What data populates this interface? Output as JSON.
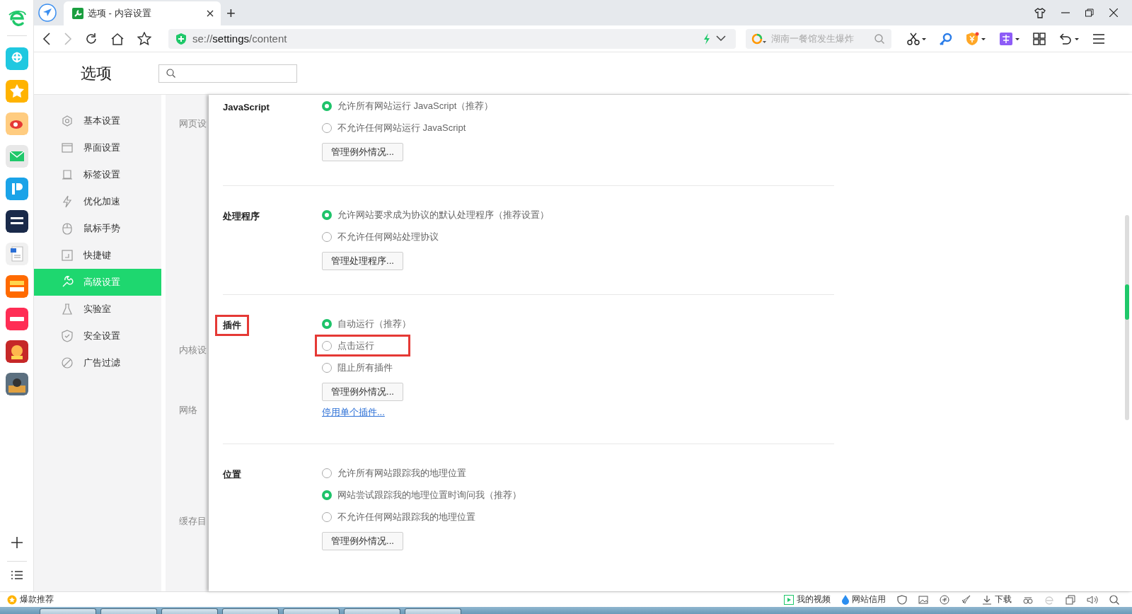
{
  "browser": {
    "tab": {
      "title": "选项 - 内容设置",
      "selected": true
    },
    "new_tab": "+",
    "address": "se://**settings**/content",
    "search": {
      "placeholder": "湖南一餐馆发生爆炸"
    }
  },
  "settings": {
    "title": "选项",
    "nav": [
      {
        "label": "基本设置",
        "selected": false
      },
      {
        "label": "界面设置",
        "selected": false
      },
      {
        "label": "标签设置",
        "selected": false
      },
      {
        "label": "优化加速",
        "selected": false
      },
      {
        "label": "鼠标手势",
        "selected": false
      },
      {
        "label": "快捷键",
        "selected": false
      },
      {
        "label": "高级设置",
        "selected": true
      },
      {
        "label": "实验室",
        "selected": false
      },
      {
        "label": "安全设置",
        "selected": false
      },
      {
        "label": "广告过滤",
        "selected": false
      }
    ],
    "side_labels": [
      "网页设",
      "内核设",
      "网络",
      "缓存目"
    ],
    "sections": [
      {
        "heading": "JavaScript",
        "highlighted": false,
        "options": [
          {
            "label": "允许所有网站运行 JavaScript（推荐）",
            "selected": true,
            "highlighted": false
          },
          {
            "label": "不允许任何网站运行 JavaScript",
            "selected": false,
            "highlighted": false
          }
        ],
        "buttons": [
          "管理例外情况..."
        ]
      },
      {
        "heading": "处理程序",
        "highlighted": false,
        "options": [
          {
            "label": "允许网站要求成为协议的默认处理程序（推荐设置）",
            "selected": true,
            "highlighted": false
          },
          {
            "label": "不允许任何网站处理协议",
            "selected": false,
            "highlighted": false
          }
        ],
        "buttons": [
          "管理处理程序..."
        ]
      },
      {
        "heading": "插件",
        "highlighted": true,
        "options": [
          {
            "label": "自动运行（推荐）",
            "selected": true,
            "highlighted": false
          },
          {
            "label": "点击运行",
            "selected": false,
            "highlighted": true
          },
          {
            "label": "阻止所有插件",
            "selected": false,
            "highlighted": false
          }
        ],
        "buttons": [
          "管理例外情况..."
        ],
        "links": [
          "停用单个插件..."
        ]
      },
      {
        "heading": "位置",
        "highlighted": false,
        "options": [
          {
            "label": "允许所有网站跟踪我的地理位置",
            "selected": false,
            "highlighted": false
          },
          {
            "label": "网站尝试跟踪我的地理位置时询问我（推荐）",
            "selected": true,
            "highlighted": false
          },
          {
            "label": "不允许任何网站跟踪我的地理位置",
            "selected": false,
            "highlighted": false
          }
        ],
        "buttons": [
          "管理例外情况..."
        ]
      }
    ]
  },
  "status_bar": {
    "promo": "爆款推荐",
    "items": [
      {
        "kind": "video",
        "label": "我的视频"
      },
      {
        "kind": "credit",
        "label": "网站信用"
      },
      {
        "kind": "download",
        "label": "下载"
      }
    ]
  }
}
